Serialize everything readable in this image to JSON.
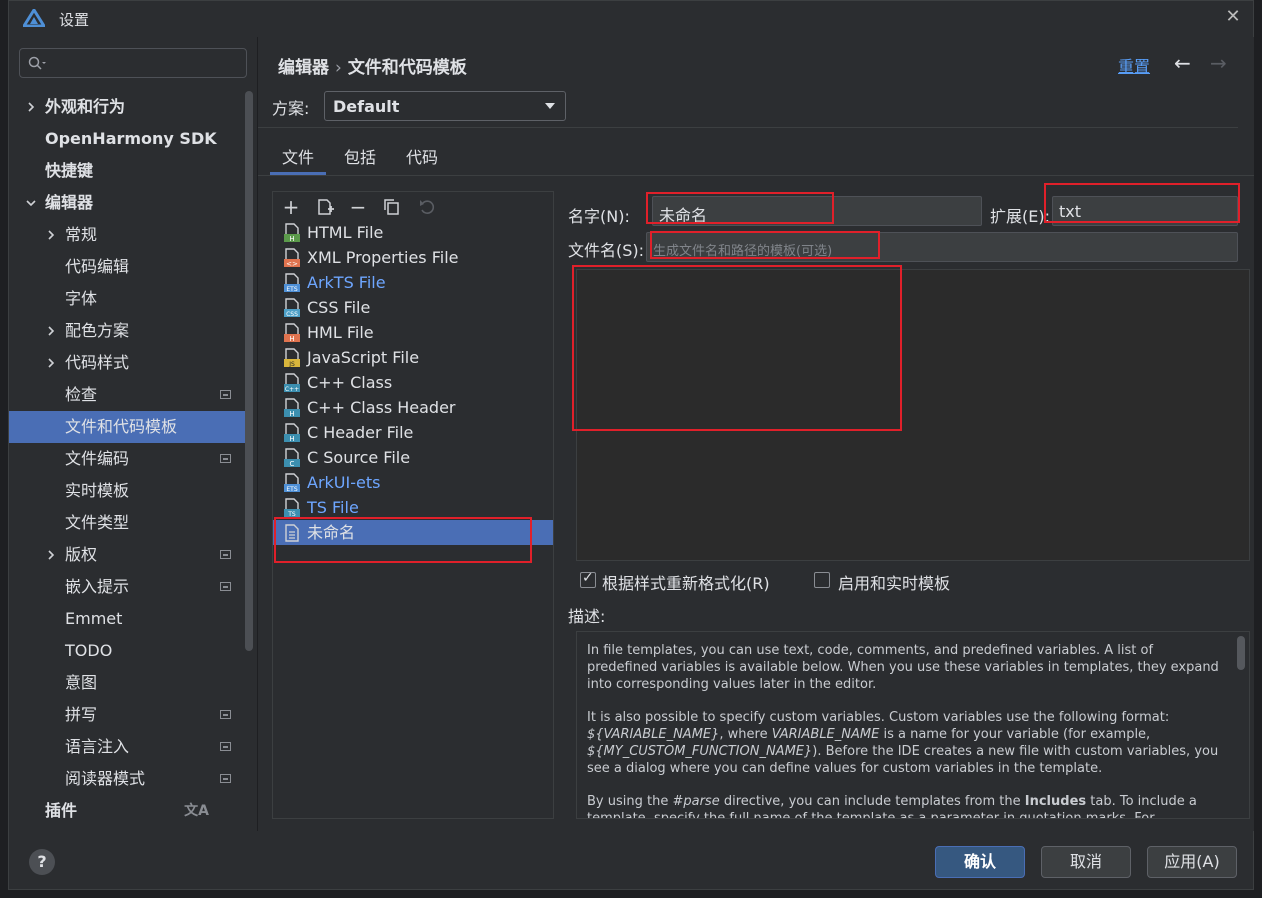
{
  "window": {
    "title": "设置"
  },
  "search": {
    "placeholder": ""
  },
  "sidebar": {
    "items": [
      {
        "label": "外观和行为"
      },
      {
        "label": "OpenHarmony SDK"
      },
      {
        "label": "快捷键"
      },
      {
        "label": "编辑器"
      },
      {
        "label": "常规"
      },
      {
        "label": "代码编辑"
      },
      {
        "label": "字体"
      },
      {
        "label": "配色方案"
      },
      {
        "label": "代码样式"
      },
      {
        "label": "检查"
      },
      {
        "label": "文件和代码模板"
      },
      {
        "label": "文件编码"
      },
      {
        "label": "实时模板"
      },
      {
        "label": "文件类型"
      },
      {
        "label": "版权"
      },
      {
        "label": "嵌入提示"
      },
      {
        "label": "Emmet"
      },
      {
        "label": "TODO"
      },
      {
        "label": "意图"
      },
      {
        "label": "拼写"
      },
      {
        "label": "语言注入"
      },
      {
        "label": "阅读器模式"
      },
      {
        "label": "插件"
      }
    ],
    "selected": "文件和代码模板"
  },
  "header": {
    "crumb1": "编辑器",
    "crumb_sep": "›",
    "crumb2": "文件和代码模板",
    "reset": "重置"
  },
  "scheme": {
    "label": "方案:",
    "value": "Default"
  },
  "tabs": [
    {
      "label": "文件"
    },
    {
      "label": "包括"
    },
    {
      "label": "代码"
    }
  ],
  "templates": {
    "items": [
      {
        "label": "HTML File",
        "icon_text": "H",
        "icon_color": "#5b9a4b"
      },
      {
        "label": "XML Properties File",
        "icon_text": "<>",
        "icon_color": "#e0734f"
      },
      {
        "label": "ArkTS File",
        "icon_text": "ETS",
        "icon_color": "#4e8fd6"
      },
      {
        "label": "CSS File",
        "icon_text": "CSS",
        "icon_color": "#4ea0c8"
      },
      {
        "label": "HML File",
        "icon_text": "H",
        "icon_color": "#e0734f"
      },
      {
        "label": "JavaScript File",
        "icon_text": "JS",
        "icon_color": "#d9b63c"
      },
      {
        "label": "C++ Class",
        "icon_text": "C++",
        "icon_color": "#3c8fb0"
      },
      {
        "label": "C++ Class Header",
        "icon_text": "H",
        "icon_color": "#3c8fb0"
      },
      {
        "label": "C Header File",
        "icon_text": "H",
        "icon_color": "#3c8fb0"
      },
      {
        "label": "C Source File",
        "icon_text": "C",
        "icon_color": "#3c8fb0"
      },
      {
        "label": "ArkUI-ets",
        "icon_text": "ETS",
        "icon_color": "#4e8fd6"
      },
      {
        "label": "TS File",
        "icon_text": "TS",
        "icon_color": "#3c8fb0"
      },
      {
        "label": "未命名",
        "icon_text": "",
        "icon_color": "#8a8d93"
      }
    ],
    "selected": "未命名"
  },
  "form": {
    "name_label": "名字(N):",
    "name_value": "未命名",
    "ext_label": "扩展(E):",
    "ext_value": "txt",
    "filename_label": "文件名(S):",
    "filename_placeholder": "生成文件名和路径的模板(可选)",
    "reformat_label": "根据样式重新格式化(R)",
    "reformat_checked": true,
    "live_label": "启用和实时模板",
    "live_checked": false,
    "desc_label": "描述:"
  },
  "description": {
    "p1": "In file templates, you can use text, code, comments, and predefined variables. A list of predefined variables is available below. When you use these variables in templates, they expand into corresponding values later in the editor.",
    "p2a": "It is also possible to specify custom variables. Custom variables use the following format: ",
    "p2_var1": "${VARIABLE_NAME}",
    "p2b": ", where ",
    "p2_var2": "VARIABLE_NAME",
    "p2c": " is a name for your variable (for example, ",
    "p2_var3": "${MY_CUSTOM_FUNCTION_NAME}",
    "p2d": "). Before the IDE creates a new file with custom variables, you see a dialog where you can define values for custom variables in the template.",
    "p3a": "By using the ",
    "p3_dir": "#parse",
    "p3b": " directive, you can include templates from the ",
    "p3_tab": "Includes",
    "p3c": " tab. To include a template, specify the full name of the template as a parameter in quotation marks. For"
  },
  "buttons": {
    "ok": "确认",
    "cancel": "取消",
    "apply": "应用(A)",
    "help": "?"
  },
  "colors": {
    "accent": "#4a6eb5",
    "highlight_box": "#e0202a",
    "link": "#589df6"
  }
}
